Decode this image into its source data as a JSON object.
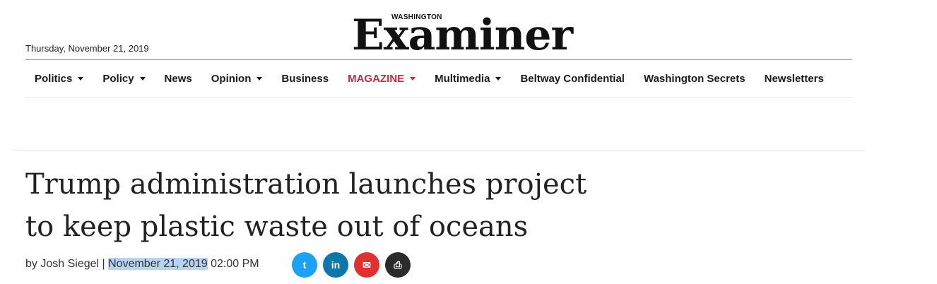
{
  "masthead": {
    "date": "Thursday, November 21, 2019",
    "logo_small": "WASHINGTON",
    "logo_big": "Examiner"
  },
  "nav": {
    "items": [
      {
        "label": "Politics",
        "dropdown": true
      },
      {
        "label": "Policy",
        "dropdown": true
      },
      {
        "label": "News",
        "dropdown": false
      },
      {
        "label": "Opinion",
        "dropdown": true
      },
      {
        "label": "Business",
        "dropdown": false
      },
      {
        "label": "MAGAZINE",
        "dropdown": true,
        "color": "#c9283e"
      },
      {
        "label": "Multimedia",
        "dropdown": true
      },
      {
        "label": "Beltway Confidential",
        "dropdown": false
      },
      {
        "label": "Washington Secrets",
        "dropdown": false
      },
      {
        "label": "Newsletters",
        "dropdown": false
      }
    ]
  },
  "article": {
    "headline": "Trump administration launches project to keep plastic waste out of oceans",
    "byline_prefix": "by Josh Siegel | ",
    "date": "November 21, 2019",
    "time": " 02:00 PM"
  },
  "share": {
    "twitter_glyph": "t",
    "linkedin_glyph": "in",
    "email_glyph": "✉",
    "print_glyph": "⎙"
  },
  "colors": {
    "accent": "#c9283e",
    "twitter": "#1da1f2",
    "linkedin": "#0e76a8",
    "email": "#e03131",
    "print": "#2b2b2b"
  }
}
